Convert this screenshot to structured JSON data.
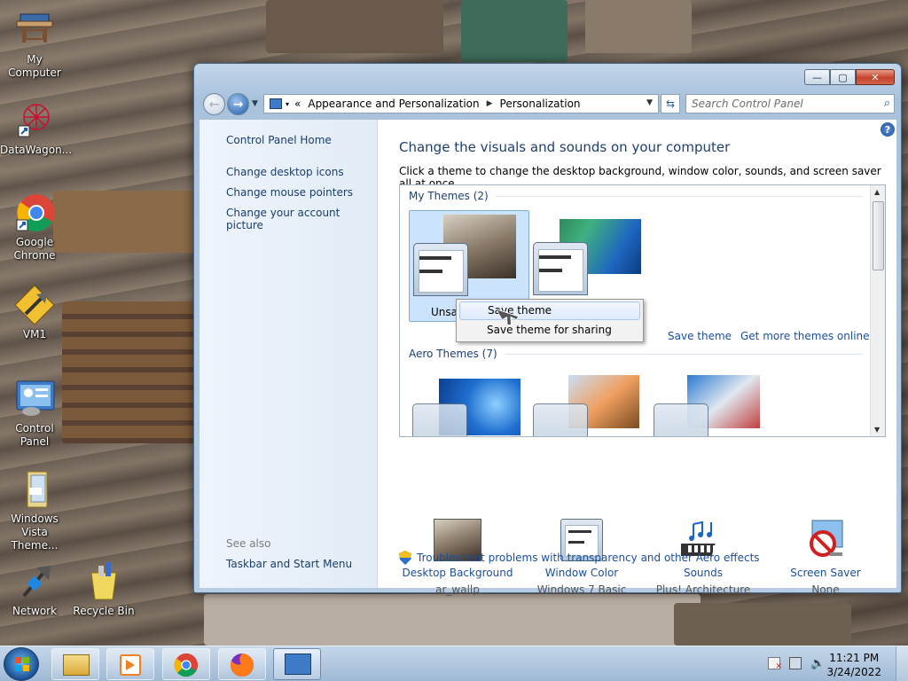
{
  "desktop": {
    "icons": [
      {
        "label": "My Computer",
        "icon": "computer-icon"
      },
      {
        "label": "DataWagon...",
        "icon": "datawagon-icon"
      },
      {
        "label": "Google Chrome",
        "icon": "chrome-icon"
      },
      {
        "label": "VM1",
        "icon": "vm-icon"
      },
      {
        "label": "Control Panel",
        "icon": "control-panel-icon"
      },
      {
        "label": "Windows Vista Theme...",
        "icon": "folder-icon"
      },
      {
        "label": "Network",
        "icon": "network-icon"
      },
      {
        "label": "Recycle Bin",
        "icon": "recycle-bin-icon"
      }
    ]
  },
  "window": {
    "caption_buttons": {
      "minimize": "—",
      "maximize": "▢",
      "close": "✕"
    },
    "breadcrumb": {
      "root_chevron": "«",
      "items": [
        "Appearance and Personalization",
        "Personalization"
      ]
    },
    "search": {
      "placeholder": "Search Control Panel"
    },
    "left_pane": {
      "home": "Control Panel Home",
      "links": [
        "Change desktop icons",
        "Change mouse pointers",
        "Change your account picture"
      ],
      "see_also_label": "See also",
      "see_also_links": [
        "Taskbar and Start Menu"
      ]
    },
    "main": {
      "title": "Change the visuals and sounds on your computer",
      "subtitle": "Click a theme to change the desktop background, window color, sounds, and screen saver all at once.",
      "my_themes_header": "My Themes (2)",
      "unsaved_label": "Unsaved Theme",
      "save_theme_link": "Save theme",
      "get_more_link": "Get more themes online",
      "aero_header": "Aero Themes (7)",
      "context_menu": [
        "Save theme",
        "Save theme for sharing"
      ],
      "bottom": [
        {
          "label": "Desktop Background",
          "sub": "ar_wallp"
        },
        {
          "label": "Window Color",
          "sub": "Windows 7 Basic"
        },
        {
          "label": "Sounds",
          "sub": "Plus! Architecture"
        },
        {
          "label": "Screen Saver",
          "sub": "None"
        }
      ],
      "troubleshoot_link": "Troubleshoot problems with transparency and other Aero effects"
    }
  },
  "taskbar": {
    "clock": {
      "time": "11:21 PM",
      "date": "3/24/2022"
    }
  }
}
